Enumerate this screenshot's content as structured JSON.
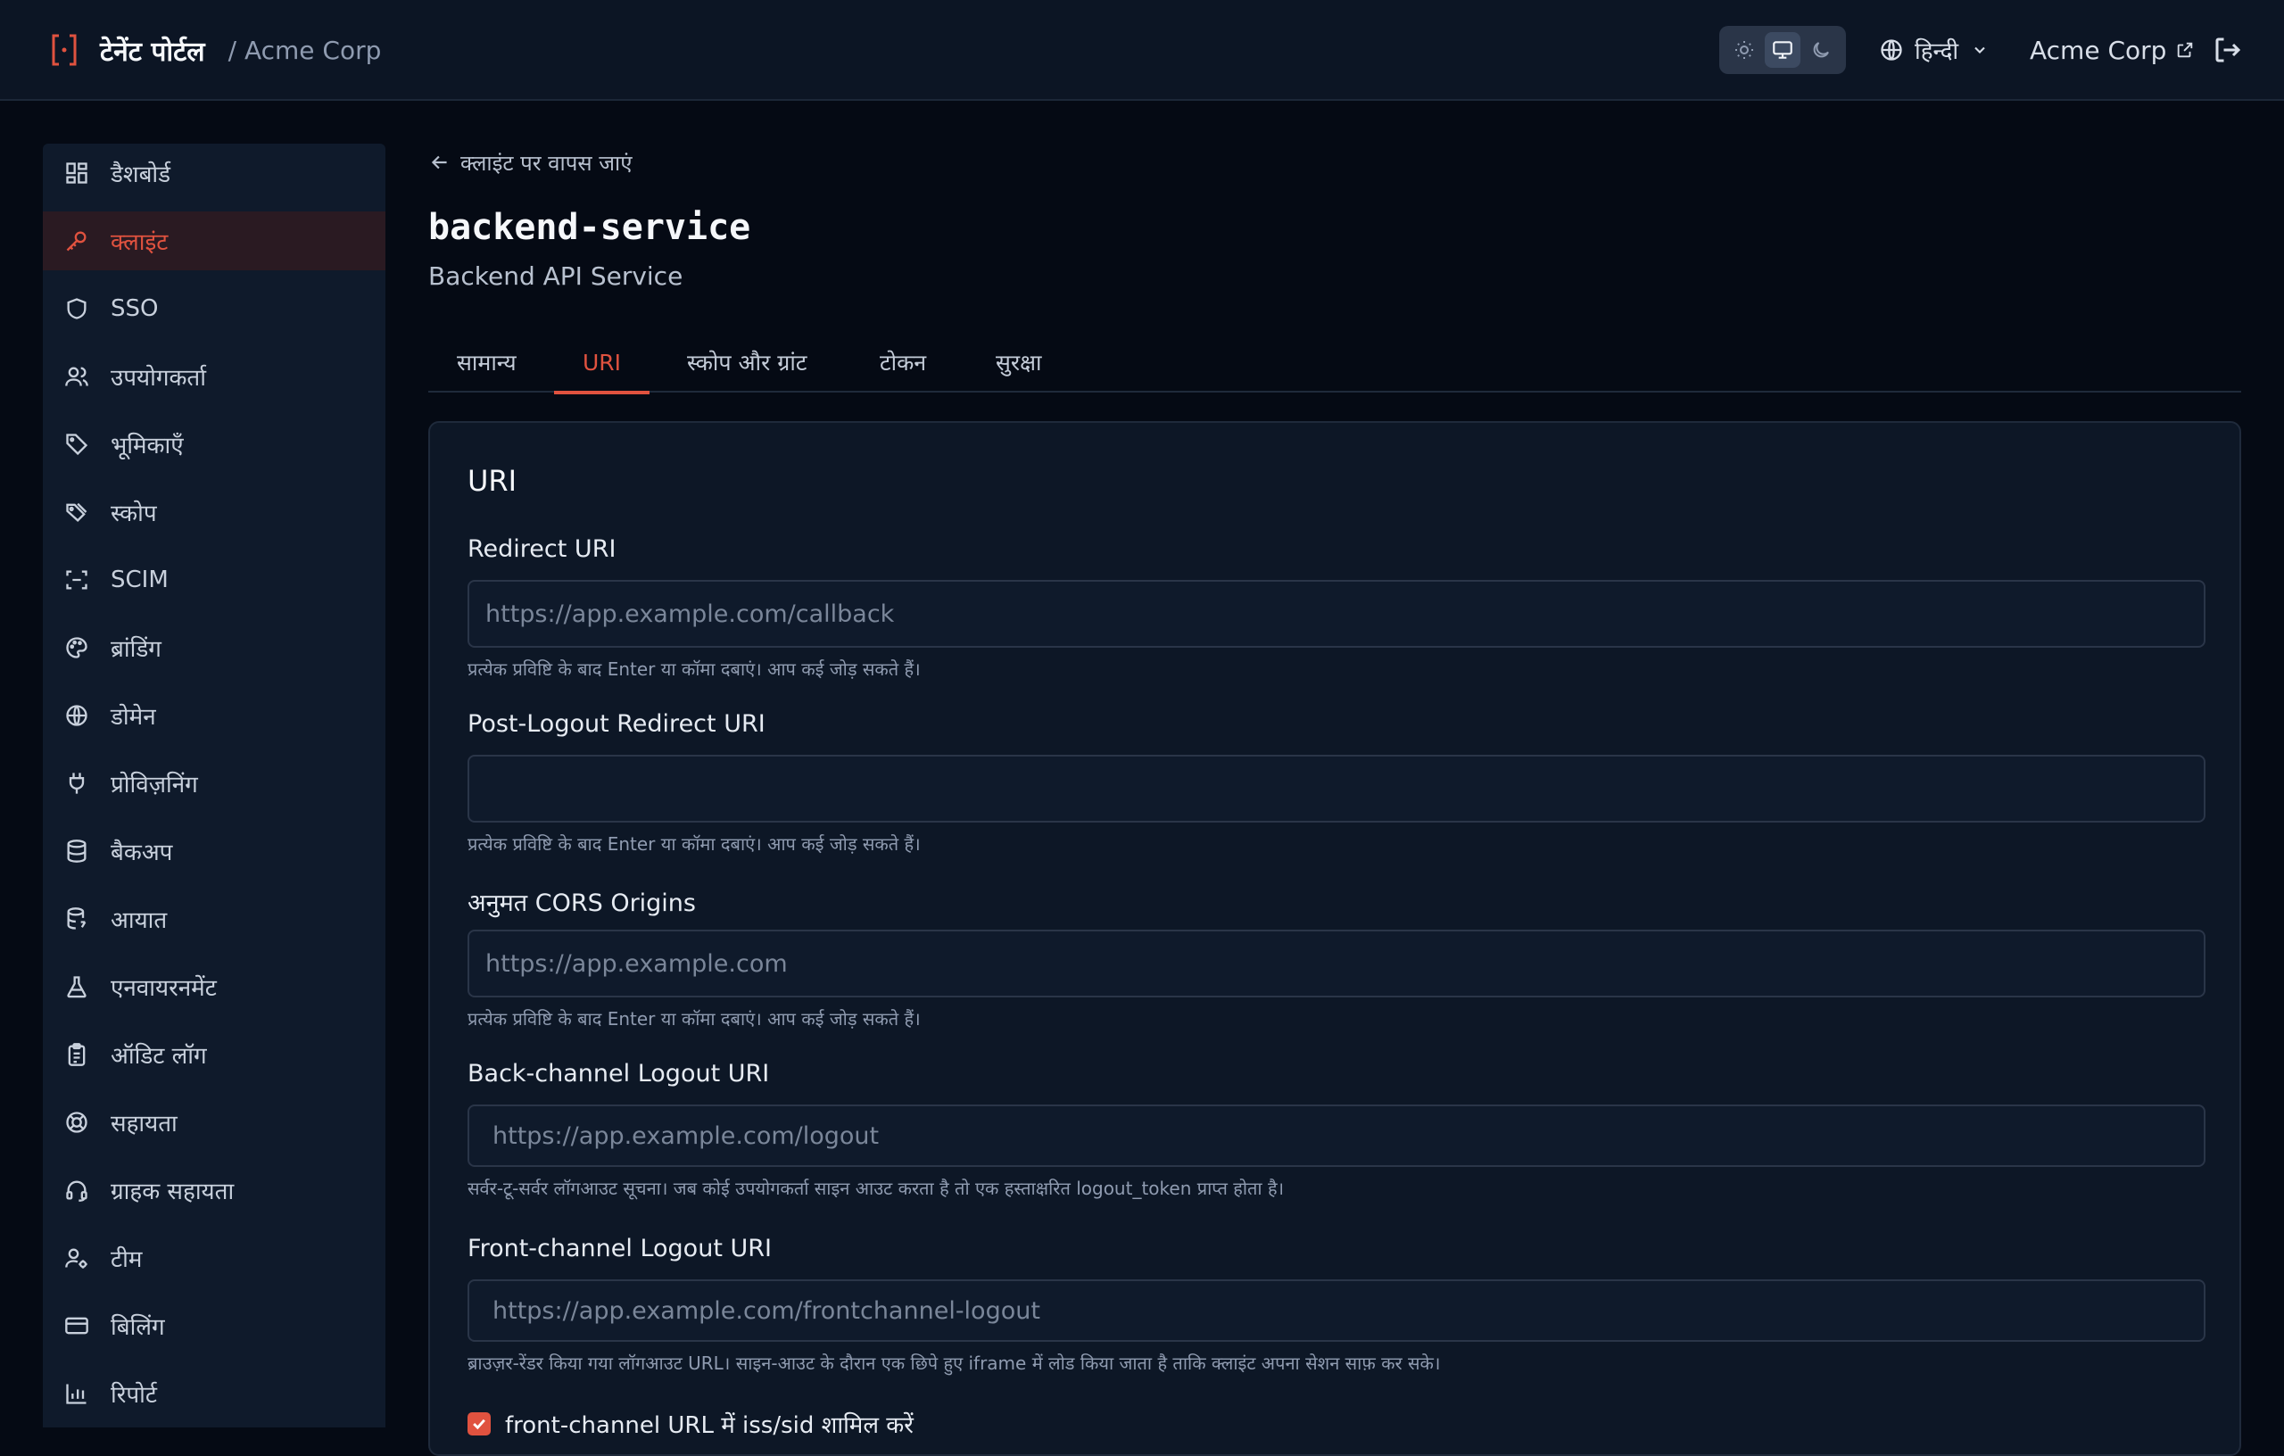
{
  "header": {
    "title": "टेनेंट पोर्टल",
    "org": "/ Acme Corp",
    "language": "हिन्दी",
    "org_link": "Acme Corp"
  },
  "sidebar": {
    "items": [
      {
        "label": "डैशबोर्ड",
        "icon": "dashboard-icon"
      },
      {
        "label": "क्लाइंट",
        "icon": "key-icon",
        "active": true
      },
      {
        "label": "SSO",
        "icon": "shield-icon"
      },
      {
        "label": "उपयोगकर्ता",
        "icon": "users-icon"
      },
      {
        "label": "भूमिकाएँ",
        "icon": "tag-icon"
      },
      {
        "label": "स्कोप",
        "icon": "tags-icon"
      },
      {
        "label": "SCIM",
        "icon": "scan-icon"
      },
      {
        "label": "ब्रांडिंग",
        "icon": "palette-icon"
      },
      {
        "label": "डोमेन",
        "icon": "globe-icon"
      },
      {
        "label": "प्रोविज़निंग",
        "icon": "plug-icon"
      },
      {
        "label": "बैकअप",
        "icon": "database-icon"
      },
      {
        "label": "आयात",
        "icon": "database-import-icon"
      },
      {
        "label": "एनवायरनमेंट",
        "icon": "flask-icon"
      },
      {
        "label": "ऑडिट लॉग",
        "icon": "clipboard-icon"
      },
      {
        "label": "सहायता",
        "icon": "lifebuoy-icon"
      },
      {
        "label": "ग्राहक सहायता",
        "icon": "headset-icon"
      },
      {
        "label": "टीम",
        "icon": "user-cog-icon"
      },
      {
        "label": "बिलिंग",
        "icon": "credit-card-icon"
      },
      {
        "label": "रिपोर्ट",
        "icon": "chart-icon"
      }
    ]
  },
  "main": {
    "back_label": "क्लाइंट पर वापस जाएं",
    "title": "backend-service",
    "subtitle": "Backend API Service",
    "tabs": [
      {
        "label": "सामान्य"
      },
      {
        "label": "URI",
        "active": true
      },
      {
        "label": "स्कोप और ग्रांट"
      },
      {
        "label": "टोकन"
      },
      {
        "label": "सुरक्षा"
      }
    ],
    "card": {
      "title": "URI",
      "fields": [
        {
          "label": "Redirect URI",
          "placeholder": "https://app.example.com/callback",
          "help": "प्रत्येक प्रविष्टि के बाद Enter या कॉमा दबाएं। आप कई जोड़ सकते हैं।"
        },
        {
          "label": "Post-Logout Redirect URI",
          "placeholder": "",
          "help": "प्रत्येक प्रविष्टि के बाद Enter या कॉमा दबाएं। आप कई जोड़ सकते हैं।"
        },
        {
          "label": "अनुमत CORS Origins",
          "placeholder": "https://app.example.com",
          "help": "प्रत्येक प्रविष्टि के बाद Enter या कॉमा दबाएं। आप कई जोड़ सकते हैं।"
        },
        {
          "label": "Back-channel Logout URI",
          "placeholder": "https://app.example.com/logout",
          "help": "सर्वर-टू-सर्वर लॉगआउट सूचना। जब कोई उपयोगकर्ता साइन आउट करता है तो एक हस्ताक्षरित logout_token प्राप्त होता है।"
        },
        {
          "label": "Front-channel Logout URI",
          "placeholder": "https://app.example.com/frontchannel-logout",
          "help": "ब्राउज़र-रेंडर किया गया लॉगआउट URL। साइन-आउट के दौरान एक छिपे हुए iframe में लोड किया जाता है ताकि क्लाइंट अपना सेशन साफ़ कर सके।"
        }
      ],
      "checkbox_label": "front-channel URL में iss/sid शामिल करें",
      "checkbox_checked": true
    }
  },
  "colors": {
    "accent": "#e0523f",
    "background": "#050a14",
    "surface": "#0d1726"
  }
}
